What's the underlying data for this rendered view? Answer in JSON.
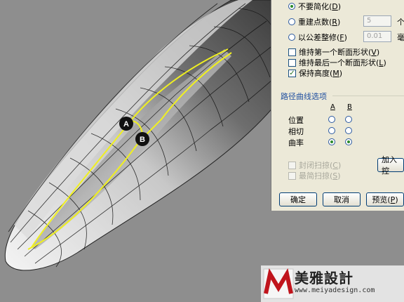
{
  "viewport": {
    "marker_a": "A",
    "marker_b": "B"
  },
  "panel": {
    "options": [
      {
        "label": "不要简化",
        "key": "D",
        "selected": true
      },
      {
        "label": "重建点数",
        "key": "R",
        "selected": false,
        "value": "5",
        "unit": "个"
      },
      {
        "label": "以公差整修",
        "key": "F",
        "selected": false,
        "value": "0.01",
        "unit": "毫"
      }
    ],
    "checks": [
      {
        "label": "维持第一个断面形状",
        "key": "V",
        "checked": false
      },
      {
        "label": "维持最后一个断面形状",
        "key": "L",
        "checked": false
      },
      {
        "label": "保持高度",
        "key": "M",
        "checked": true
      }
    ],
    "path_section": "路径曲线选项",
    "columns": [
      "A",
      "B"
    ],
    "rows": [
      {
        "label": "位置",
        "a": false,
        "b": false
      },
      {
        "label": "相切",
        "a": false,
        "b": false
      },
      {
        "label": "曲率",
        "a": true,
        "b": true
      }
    ],
    "disabled_checks": [
      {
        "label": "封闭扫掠",
        "key": "C"
      },
      {
        "label": "最简扫掠",
        "key": "S"
      }
    ],
    "add_button": "加入控",
    "buttons": [
      {
        "label": "确定"
      },
      {
        "label": "取消"
      },
      {
        "label": "预览",
        "key": "P"
      }
    ]
  },
  "watermark": {
    "title": "美雅設計",
    "url": "www.meiyadesign.com"
  },
  "colors": {
    "background": "#8e8e8e",
    "panel": "#ece9d8",
    "highlight_curve": "#f0f020",
    "section_title": "#2150a0"
  }
}
